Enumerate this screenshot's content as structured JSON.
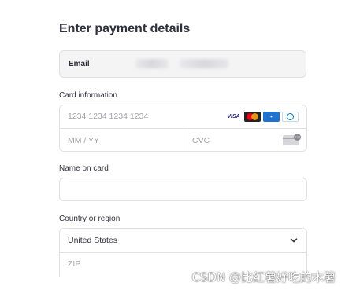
{
  "title": "Enter payment details",
  "email": {
    "label": "Email"
  },
  "card": {
    "section_label": "Card information",
    "number_placeholder": "1234 1234 1234 1234",
    "expiry_placeholder": "MM / YY",
    "cvc_placeholder": "CVC",
    "brands": [
      "VISA",
      "mastercard-icon",
      "amex-icon",
      "diners-icon"
    ]
  },
  "name": {
    "section_label": "Name on card",
    "value": ""
  },
  "country": {
    "section_label": "Country or region",
    "selected": "United States",
    "zip_placeholder": "ZIP"
  },
  "watermark": "CSDN @比红薯好吃的木薯"
}
